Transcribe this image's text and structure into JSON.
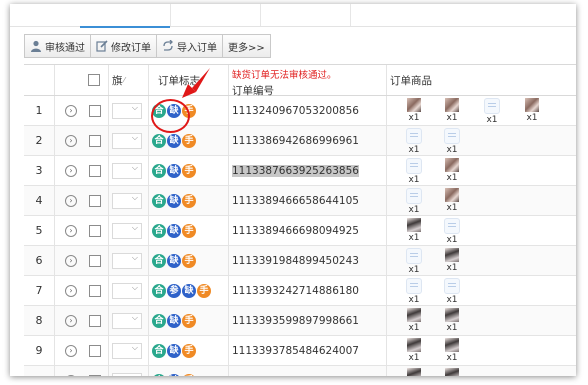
{
  "toolbar": {
    "buttons": [
      {
        "label": "审核通过",
        "icon": "user-icon"
      },
      {
        "label": "修改订单",
        "icon": "edit-icon"
      },
      {
        "label": "导入订单",
        "icon": "import-icon"
      },
      {
        "label": "更多>>",
        "icon": ""
      }
    ]
  },
  "annotation": "缺货订单无法审核通过。",
  "header": {
    "flag": "旗",
    "tags": "订单标志",
    "order_no": "订单编号",
    "goods": "订单商品"
  },
  "badge_labels": {
    "he": "合",
    "que": "缺",
    "shou": "手",
    "can": "参"
  },
  "colors": {
    "he": "#2aa88d",
    "que": "#2f62c9",
    "shou": "#f08a25",
    "can": "#2f62c9",
    "annotation": "#e01818",
    "highlight": "#c7c7c7"
  },
  "rows": [
    {
      "num": "1",
      "order_no": "1113240967053200856",
      "tags": [
        "he",
        "que",
        "shou"
      ],
      "goods": [
        {
          "type": "photo",
          "qty": "x1"
        },
        {
          "type": "photo",
          "qty": "x1"
        },
        {
          "type": "doc",
          "qty": "x1"
        },
        {
          "type": "photo",
          "qty": "x1"
        }
      ]
    },
    {
      "num": "2",
      "order_no": "1113386942686996961",
      "tags": [
        "he",
        "que",
        "shou"
      ],
      "goods": [
        {
          "type": "doc",
          "qty": "x1"
        },
        {
          "type": "doc",
          "qty": "x1"
        }
      ]
    },
    {
      "num": "3",
      "order_no": "1113387663925263856",
      "highlight": true,
      "tags": [
        "he",
        "que",
        "shou"
      ],
      "goods": [
        {
          "type": "doc",
          "qty": "x1"
        },
        {
          "type": "photo",
          "qty": "x1"
        }
      ]
    },
    {
      "num": "4",
      "order_no": "1113389466658644105",
      "tags": [
        "he",
        "que",
        "shou"
      ],
      "goods": [
        {
          "type": "doc",
          "qty": "x1"
        },
        {
          "type": "photo",
          "qty": "x1"
        }
      ]
    },
    {
      "num": "5",
      "order_no": "1113389466698094925",
      "tags": [
        "he",
        "que",
        "shou"
      ],
      "goods": [
        {
          "type": "photo2",
          "qty": "x1"
        },
        {
          "type": "doc",
          "qty": "x1"
        }
      ]
    },
    {
      "num": "6",
      "order_no": "1113391984899450243",
      "tags": [
        "he",
        "que",
        "shou"
      ],
      "goods": [
        {
          "type": "doc",
          "qty": "x1"
        },
        {
          "type": "photo2",
          "qty": "x1"
        }
      ]
    },
    {
      "num": "7",
      "order_no": "1113393242714886180",
      "tags": [
        "he",
        "can",
        "que",
        "shou"
      ],
      "goods": [
        {
          "type": "doc",
          "qty": "x1"
        },
        {
          "type": "doc",
          "qty": "x1"
        }
      ]
    },
    {
      "num": "8",
      "order_no": "1113393599897998661",
      "tags": [
        "he",
        "que",
        "shou"
      ],
      "goods": [
        {
          "type": "photo2",
          "qty": "x1"
        },
        {
          "type": "photo2",
          "qty": "x1"
        }
      ]
    },
    {
      "num": "9",
      "order_no": "1113393785484624007",
      "tags": [
        "he",
        "que",
        "shou"
      ],
      "goods": [
        {
          "type": "photo2",
          "qty": "x1"
        },
        {
          "type": "photo2",
          "qty": "x1"
        }
      ]
    },
    {
      "num": "",
      "order_no": "",
      "tags": [
        "he",
        "que",
        "shou"
      ],
      "goods": [
        {
          "type": "photo2",
          "qty": ""
        },
        {
          "type": "photo2",
          "qty": ""
        }
      ]
    }
  ]
}
